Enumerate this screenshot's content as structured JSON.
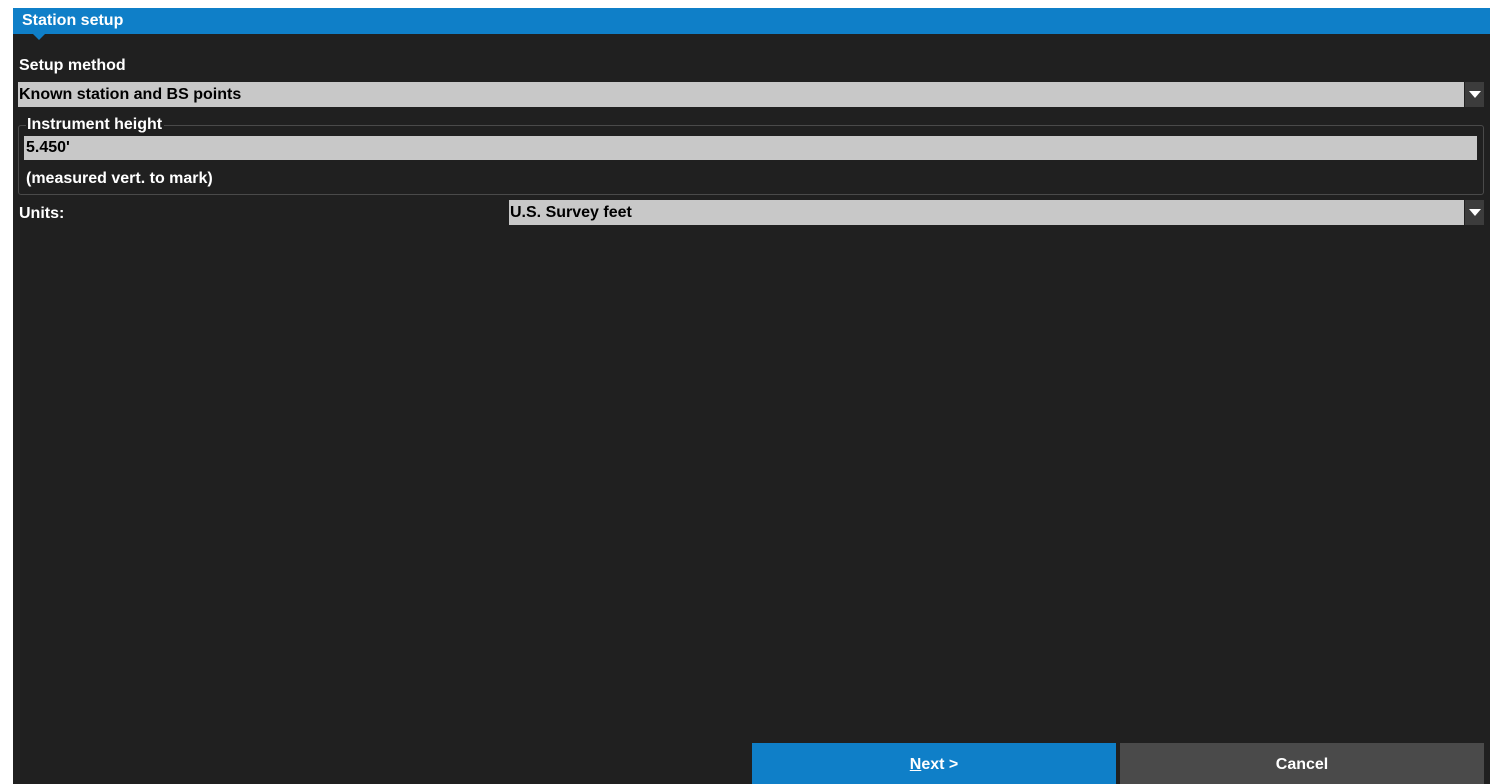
{
  "window": {
    "title": "Station setup"
  },
  "setup_method": {
    "label": "Setup method",
    "value": "Known station and BS points"
  },
  "instrument_height": {
    "group_label": "Instrument height",
    "value": "5.450'",
    "note": "(measured vert. to mark)"
  },
  "units": {
    "label": "Units:",
    "value": "U.S. Survey feet"
  },
  "buttons": {
    "next_mnemonic": "N",
    "next_rest": "ext >",
    "cancel": "Cancel"
  },
  "icons": {
    "dropdown": "chevron-down-icon",
    "title_indicator": "caret-down-icon"
  },
  "colors": {
    "accent": "#0f7fc8",
    "background": "#202020",
    "field": "#c8c8c8",
    "secondary_button": "#4a4a4a"
  }
}
